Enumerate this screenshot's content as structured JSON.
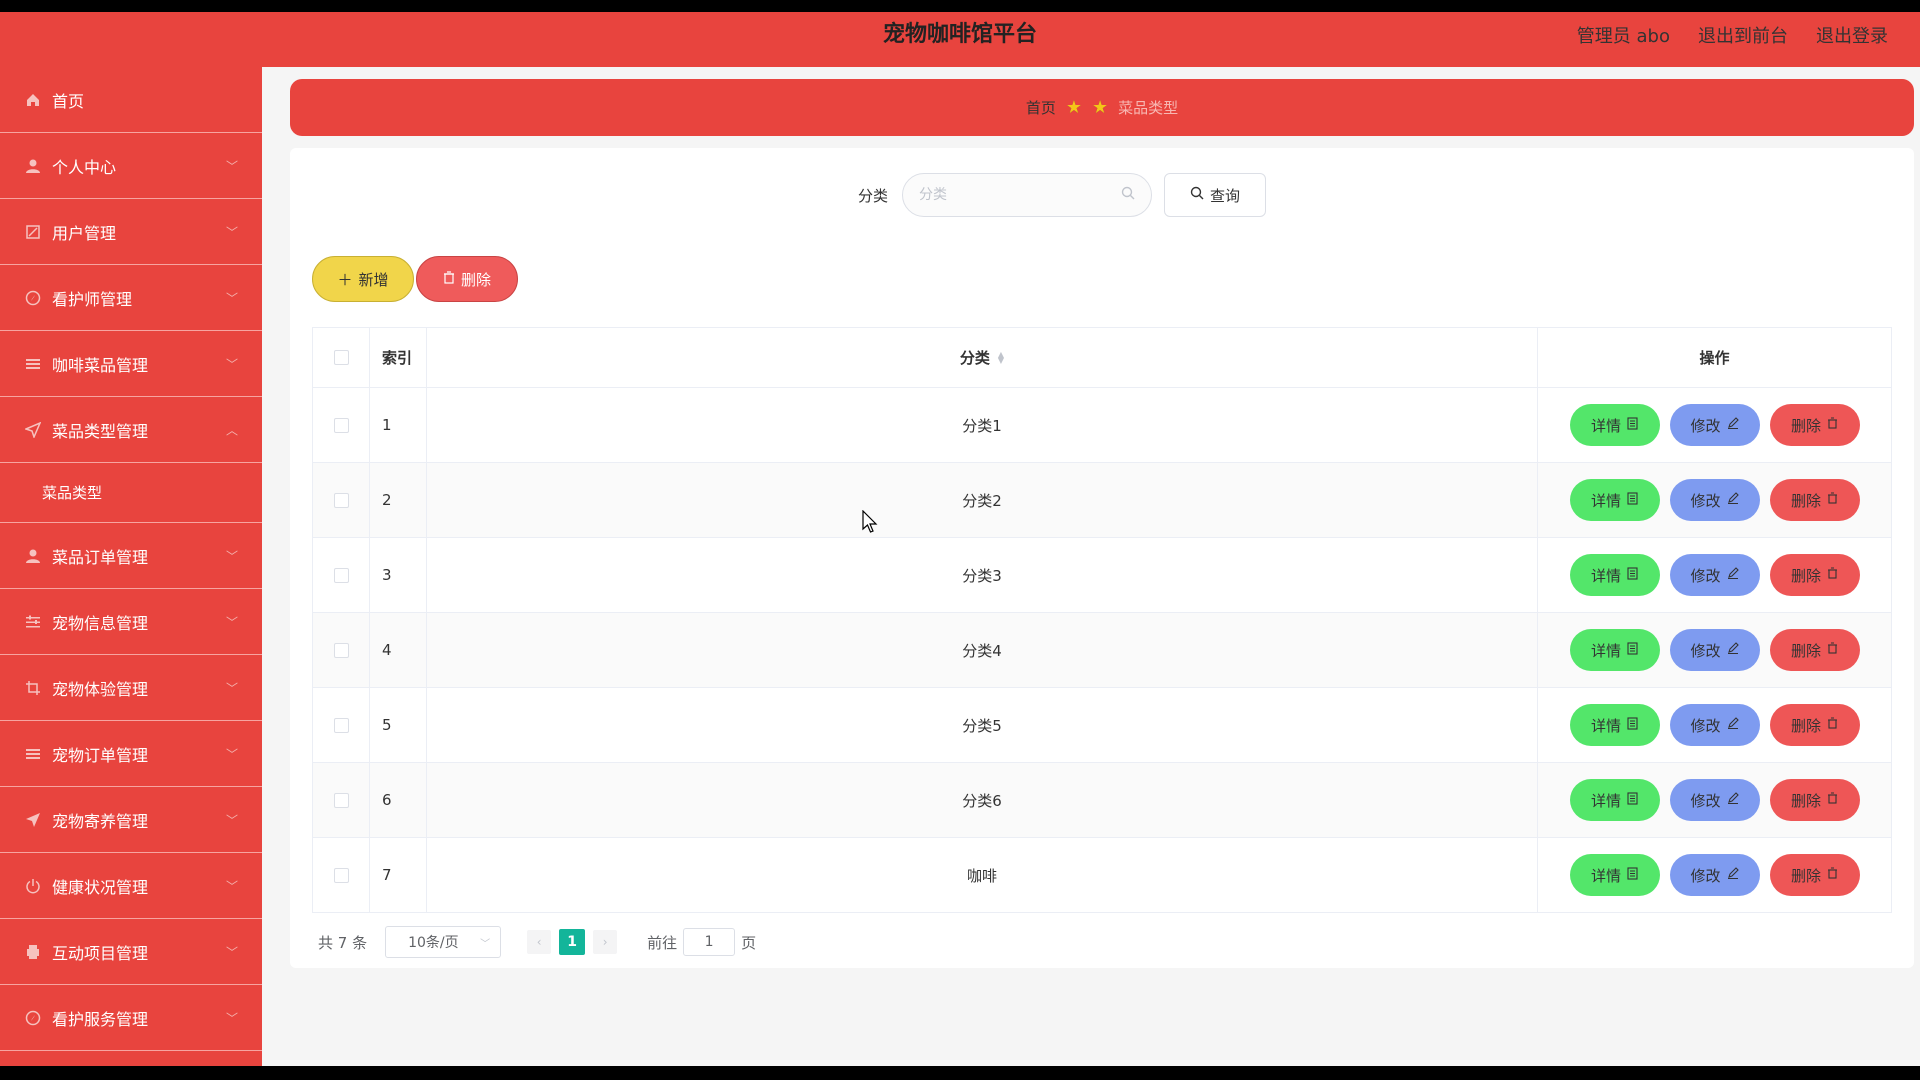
{
  "header": {
    "title": "宠物咖啡馆平台",
    "admin": "管理员 abo",
    "back_to_front": "退出到前台",
    "logout": "退出登录"
  },
  "sidebar": {
    "items": [
      {
        "label": "首页",
        "icon": "home-icon",
        "has_chevron": false
      },
      {
        "label": "个人中心",
        "icon": "user-icon",
        "has_chevron": true
      },
      {
        "label": "用户管理",
        "icon": "pen-icon",
        "has_chevron": true
      },
      {
        "label": "看护师管理",
        "icon": "compass-icon",
        "has_chevron": true
      },
      {
        "label": "咖啡菜品管理",
        "icon": "list-icon",
        "has_chevron": true
      },
      {
        "label": "菜品类型管理",
        "icon": "send-icon",
        "has_chevron": true,
        "expanded": true
      },
      {
        "label": "菜品订单管理",
        "icon": "user-icon",
        "has_chevron": true
      },
      {
        "label": "宠物信息管理",
        "icon": "sliders-icon",
        "has_chevron": true
      },
      {
        "label": "宠物体验管理",
        "icon": "crop-icon",
        "has_chevron": true
      },
      {
        "label": "宠物订单管理",
        "icon": "list-icon",
        "has_chevron": true
      },
      {
        "label": "宠物寄养管理",
        "icon": "send-icon",
        "has_chevron": true
      },
      {
        "label": "健康状况管理",
        "icon": "power-icon",
        "has_chevron": true
      },
      {
        "label": "互动项目管理",
        "icon": "printer-icon",
        "has_chevron": true
      },
      {
        "label": "看护服务管理",
        "icon": "compass-icon",
        "has_chevron": true
      }
    ],
    "submenu_label": "菜品类型"
  },
  "breadcrumb": {
    "home": "首页",
    "current": "菜品类型"
  },
  "search": {
    "label": "分类",
    "placeholder": "分类",
    "button_label": "查询"
  },
  "actions": {
    "add_label": "新增",
    "delete_label": "删除"
  },
  "table": {
    "headers": {
      "index": "索引",
      "category": "分类",
      "operations": "操作"
    },
    "rows": [
      {
        "index": "1",
        "category": "分类1"
      },
      {
        "index": "2",
        "category": "分类2"
      },
      {
        "index": "3",
        "category": "分类3"
      },
      {
        "index": "4",
        "category": "分类4"
      },
      {
        "index": "5",
        "category": "分类5"
      },
      {
        "index": "6",
        "category": "分类6"
      },
      {
        "index": "7",
        "category": "咖啡"
      }
    ],
    "op_labels": {
      "detail": "详情",
      "edit": "修改",
      "delete": "删除"
    }
  },
  "pagination": {
    "total_text": "共 7 条",
    "page_size": "10条/页",
    "current_page": "1",
    "goto_prefix": "前往",
    "goto_value": "1",
    "goto_suffix": "页"
  },
  "colors": {
    "primary_red": "#e8443e",
    "add_yellow": "#f1d54a",
    "detail_green": "#53e66a",
    "edit_blue": "#7e9bf0",
    "delete_red": "#ee5656",
    "page_active": "#13b59a"
  }
}
